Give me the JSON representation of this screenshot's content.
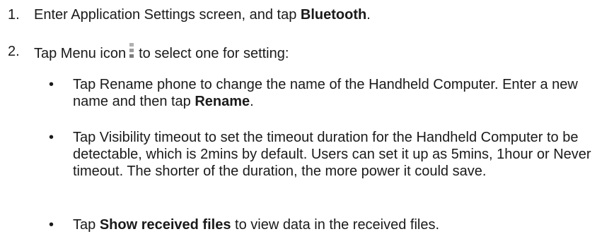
{
  "steps": [
    {
      "num": "1.",
      "text_a": "Enter Application Settings screen, and tap ",
      "bold": "Bluetooth",
      "text_b": "."
    },
    {
      "num": "2.",
      "text_a": "Tap Menu icon",
      "icon": "menu-icon",
      "text_b": "to select one for setting:"
    }
  ],
  "bullets": [
    {
      "mark": "•",
      "text_a": "Tap Rename phone to change the name of the Handheld Computer. Enter a new name and then tap ",
      "bold": "Rename",
      "text_b": "."
    },
    {
      "mark": "•",
      "text_a": "Tap Visibility timeout to set the timeout duration for the Handheld Computer to be detectable, which is 2mins by default. Users can set it up as 5mins, 1hour or Never timeout. The shorter of the duration, the more power it could save."
    },
    {
      "mark": "•",
      "text_a": "Tap ",
      "bold": "Show received files",
      "text_b": " to view data in the received files."
    }
  ]
}
